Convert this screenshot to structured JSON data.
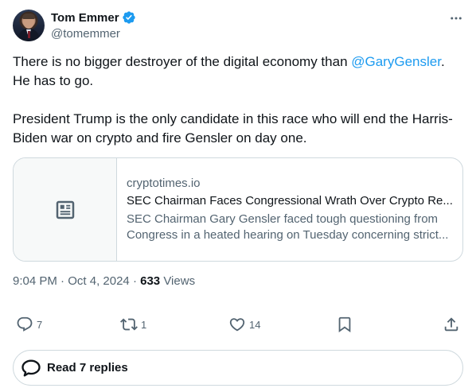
{
  "author": {
    "name": "Tom Emmer",
    "handle": "@tomemmer"
  },
  "tweet": {
    "line1_before": "There is no bigger destroyer of the digital economy than ",
    "mention": "@GaryGensler",
    "line1_after": ".",
    "line2": "He has to go.",
    "para2": "President Trump is the only candidate in this race who will end the Harris-Biden war on crypto and fire Gensler on day one."
  },
  "card": {
    "domain": "cryptotimes.io",
    "title": "SEC Chairman Faces Congressional Wrath Over Crypto Re...",
    "description": "SEC Chairman Gary Gensler faced tough questioning from Congress in a heated hearing on Tuesday concerning strict..."
  },
  "meta": {
    "time": "9:04 PM",
    "sep1": " · ",
    "date": "Oct 4, 2024",
    "sep2": " · ",
    "views_count": "633",
    "views_label": " Views"
  },
  "actions": {
    "replies": "7",
    "reposts": "1",
    "likes": "14"
  },
  "read_replies_label": "Read 7 replies",
  "colors": {
    "accent": "#1d9bf0",
    "text": "#0f1419",
    "secondary": "#536471",
    "border": "#cfd9de"
  },
  "icons": [
    "verified-badge-icon",
    "more-options-icon",
    "article-icon",
    "reply-icon",
    "repost-icon",
    "like-icon",
    "bookmark-icon",
    "share-icon",
    "speech-bubble-icon"
  ]
}
